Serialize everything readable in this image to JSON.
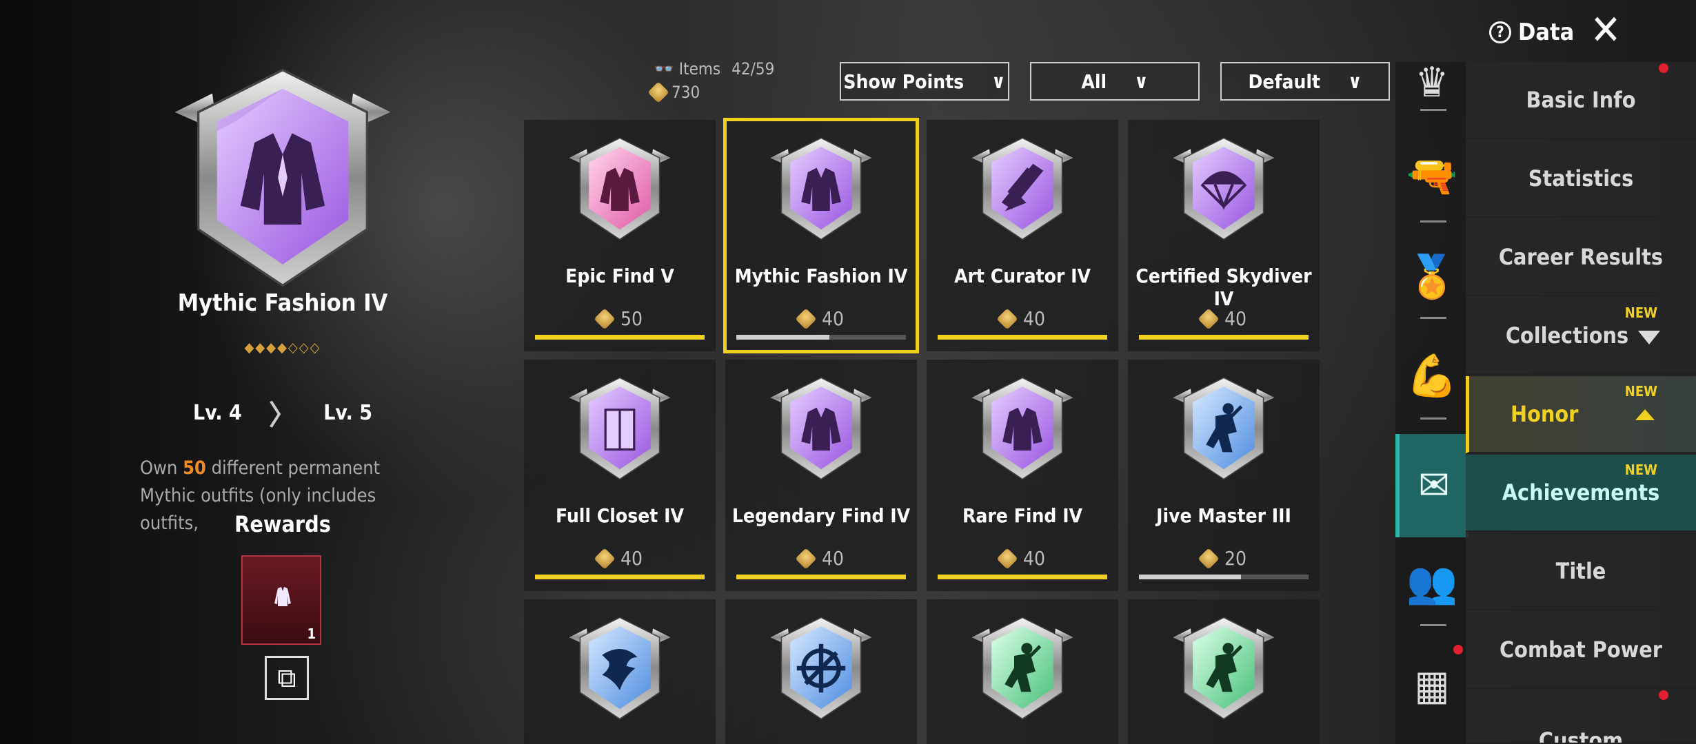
{
  "header": {
    "data_label": "Data",
    "help_icon": "question-icon",
    "close_icon": "close-icon"
  },
  "detail": {
    "title": "Mythic Fashion IV",
    "stars": "◆◆◆◆◇◇◇",
    "level_from": "Lv. 4",
    "level_to": "Lv. 5",
    "desc_pre": "Own ",
    "desc_highlight": "50",
    "desc_post": " different permanent Mythic outfits (only includes outfits,",
    "rewards_label": "Rewards",
    "reward_count": "1",
    "reward_icon": "jacket-icon",
    "share_icon": "share-icon"
  },
  "stats": {
    "items_label": "Items",
    "items_value": "42/59",
    "points_value": "730"
  },
  "filters": [
    {
      "label": "Show Points"
    },
    {
      "label": "All"
    },
    {
      "label": "Default"
    }
  ],
  "cards": [
    {
      "name": "Epic Find V",
      "points": "50",
      "progress": 1.0,
      "bar": "yellow",
      "color": "pink",
      "icon": "jacket"
    },
    {
      "name": "Mythic Fashion IV",
      "points": "40",
      "progress": 0.55,
      "bar": "grey",
      "color": "purple",
      "icon": "jacket",
      "selected": true
    },
    {
      "name": "Art Curator IV",
      "points": "40",
      "progress": 1.0,
      "bar": "yellow",
      "color": "purple",
      "icon": "brush"
    },
    {
      "name": "Certified Skydiver IV",
      "points": "40",
      "progress": 1.0,
      "bar": "yellow",
      "color": "purple",
      "icon": "parachute"
    },
    {
      "name": "Full Closet IV",
      "points": "40",
      "progress": 1.0,
      "bar": "yellow",
      "color": "purple",
      "icon": "closet"
    },
    {
      "name": "Legendary Find IV",
      "points": "40",
      "progress": 1.0,
      "bar": "yellow",
      "color": "purple",
      "icon": "jacket"
    },
    {
      "name": "Rare Find IV",
      "points": "40",
      "progress": 1.0,
      "bar": "yellow",
      "color": "purple",
      "icon": "jacket"
    },
    {
      "name": "Jive Master III",
      "points": "20",
      "progress": 0.6,
      "bar": "grey",
      "color": "blue",
      "icon": "dancer"
    },
    {
      "name": "",
      "points": "",
      "progress": null,
      "bar": "",
      "color": "blue",
      "icon": "eagle"
    },
    {
      "name": "",
      "points": "",
      "progress": null,
      "bar": "",
      "color": "blue",
      "icon": "crosshair"
    },
    {
      "name": "",
      "points": "",
      "progress": null,
      "bar": "",
      "color": "green",
      "icon": "dancer"
    },
    {
      "name": "",
      "points": "",
      "progress": null,
      "bar": "",
      "color": "green",
      "icon": "dancer"
    }
  ],
  "side_icons": [
    "crown-icon",
    "pistol-icon",
    "medal-icon",
    "muscle-icon",
    "achievement-icon",
    "friends-icon",
    "grid-icon"
  ],
  "menu": {
    "basic_info": "Basic Info",
    "statistics": "Statistics",
    "career_results": "Career Results",
    "collections": "Collections",
    "honor": "Honor",
    "achievements": "Achievements",
    "title": "Title",
    "combat_power": "Combat Power",
    "custom": "Custom",
    "new_tag": "NEW"
  },
  "colors": {
    "accent": "#f0d020",
    "teal": "#1f6664",
    "red_dot": "#e02030",
    "highlight": "#f08a24"
  }
}
